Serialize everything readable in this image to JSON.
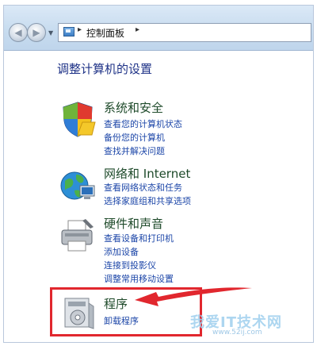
{
  "nav": {
    "back_glyph": "◀",
    "forward_glyph": "▶",
    "dropdown_glyph": "▼"
  },
  "address": {
    "separator": "▸",
    "crumb": "控制面板"
  },
  "page_heading": "调整计算机的设置",
  "categories": [
    {
      "title": "系统和安全",
      "icon": "shield-icon",
      "links": [
        "查看您的计算机状态",
        "备份您的计算机",
        "查找并解决问题"
      ]
    },
    {
      "title": "网络和 Internet",
      "icon": "network-globe-icon",
      "links": [
        "查看网络状态和任务",
        "选择家庭组和共享选项"
      ]
    },
    {
      "title": "硬件和声音",
      "icon": "printer-icon",
      "links": [
        "查看设备和打印机",
        "添加设备",
        "连接到投影仪",
        "调整常用移动设置"
      ]
    },
    {
      "title": "程序",
      "icon": "programs-icon",
      "links": [
        "卸载程序"
      ]
    }
  ],
  "annotation": {
    "color": "#e1272e"
  },
  "watermark": {
    "text": "我爱IT技术网",
    "sub": "www.52ij.com"
  }
}
